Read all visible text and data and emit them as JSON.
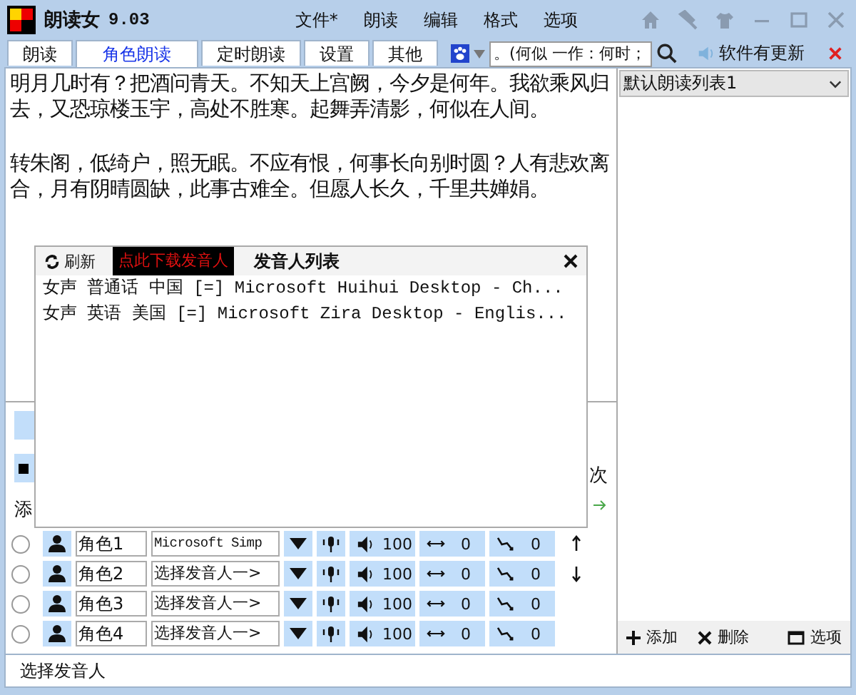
{
  "window": {
    "title": "朗读女",
    "version": "9.03"
  },
  "menu": [
    "文件*",
    "朗读",
    "编辑",
    "格式",
    "选项"
  ],
  "tabs": [
    {
      "label": "朗读",
      "selected": false
    },
    {
      "label": "角色朗读",
      "selected": true
    },
    {
      "label": "定时朗读",
      "selected": false
    },
    {
      "label": "设置",
      "selected": false
    },
    {
      "label": "其他",
      "selected": false
    }
  ],
  "search": {
    "value": "。(何似 一作：何时；"
  },
  "update_notice": "软件有更新",
  "text_content": [
    "明月几时有？把酒问青天。不知天上宫阙，今夕是何年。我欲乘风归去，又恐琼楼玉宇，高处不胜寒。起舞弄清影，何似在人间。",
    "转朱阁，低绮户，照无眠。不应有恨，何事长向别时圆？人有悲欢离合，月有阴晴圆缺，此事古难全。但愿人长久，千里共婵娟。"
  ],
  "hidden_panel": {
    "left_label": "添",
    "right_label": "次"
  },
  "voice_popup": {
    "refresh": "刷新",
    "download": "点此下载发音人",
    "title": "发音人列表",
    "voices": [
      "女声 普通话 中国 [=] Microsoft Huihui Desktop - Ch...",
      "女声 英语 美国 [=] Microsoft Zira Desktop - Englis..."
    ]
  },
  "roles": [
    {
      "selected": false,
      "name": "角色1",
      "voice": "Microsoft Simp",
      "volume": "100",
      "speed": "0",
      "pitch": "0"
    },
    {
      "selected": false,
      "name": "角色2",
      "voice": "选择发音人一>",
      "volume": "100",
      "speed": "0",
      "pitch": "0"
    },
    {
      "selected": false,
      "name": "角色3",
      "voice": "选择发音人一>",
      "volume": "100",
      "speed": "0",
      "pitch": "0"
    },
    {
      "selected": false,
      "name": "角色4",
      "voice": "选择发音人一>",
      "volume": "100",
      "speed": "0",
      "pitch": "0"
    }
  ],
  "side": {
    "list_select": "默认朗读列表1",
    "buttons": [
      {
        "kind": "add",
        "label": "添加"
      },
      {
        "kind": "delete",
        "label": "删除"
      },
      {
        "kind": "options",
        "label": "选项"
      }
    ]
  },
  "status_bar": "选择发音人"
}
